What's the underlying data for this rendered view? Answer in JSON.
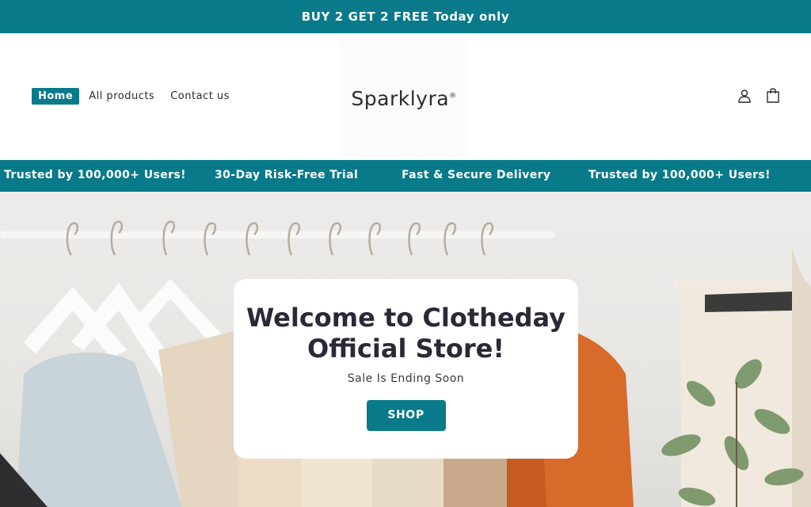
{
  "announcement": {
    "text": "BUY 2 GET 2 FREE  Today only"
  },
  "nav": {
    "items": [
      {
        "label": "Home",
        "active": true
      },
      {
        "label": "All products",
        "active": false
      },
      {
        "label": "Contact us",
        "active": false
      }
    ]
  },
  "logo": {
    "text": "Sparklyra",
    "mark": "®"
  },
  "header_icons": [
    "account-icon",
    "cart-icon"
  ],
  "ticker": {
    "items": [
      "Trusted by 100,000+ Users!",
      "30-Day Risk-Free Trial",
      "Fast & Secure Delivery",
      "Trusted by 100,000+ Users!"
    ]
  },
  "hero": {
    "title_line1": "Welcome to Clotheday",
    "title_line2": "Official Store!",
    "subtitle": "Sale Is Ending Soon",
    "button_label": "SHOP"
  },
  "colors": {
    "brand": "#087a8a",
    "title": "#2a2937",
    "white": "#ffffff"
  }
}
